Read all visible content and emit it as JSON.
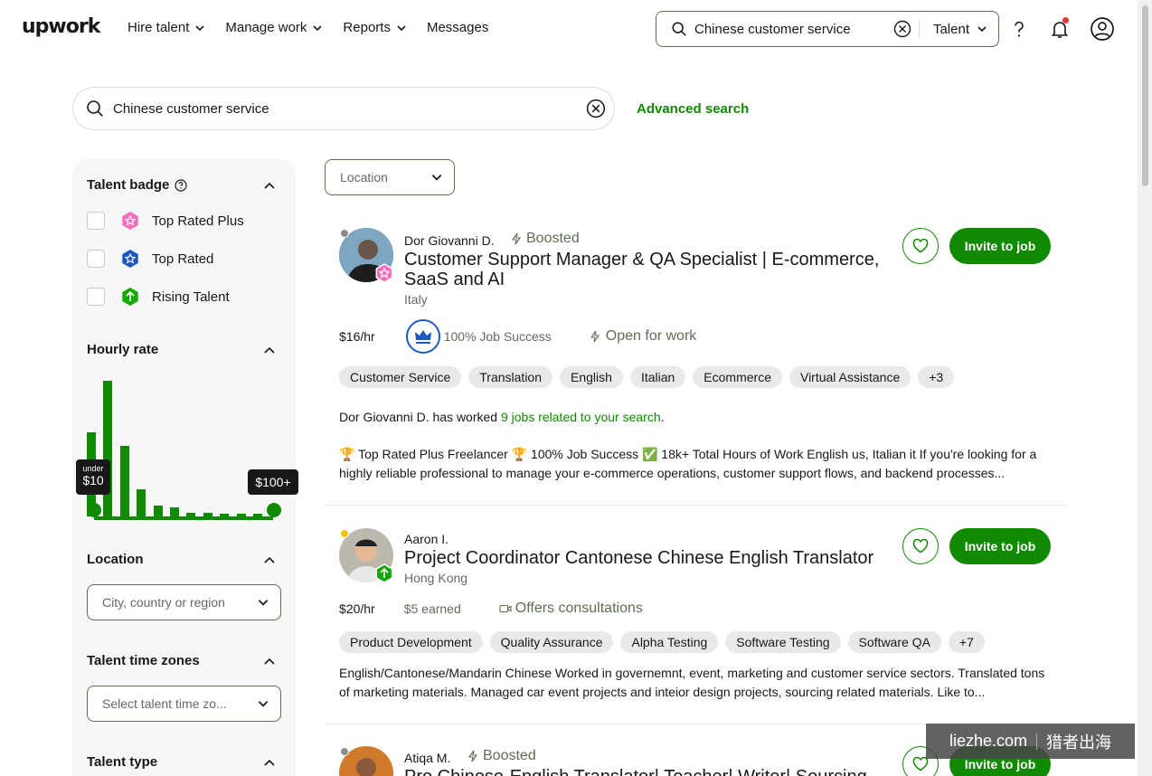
{
  "nav": {
    "logo": "upwork",
    "links": [
      "Hire talent",
      "Manage work",
      "Reports",
      "Messages"
    ],
    "search_value": "Chinese customer service",
    "search_scope": "Talent"
  },
  "search": {
    "value": "Chinese customer service",
    "advanced_label": "Advanced search"
  },
  "sidebar": {
    "talent_badge_title": "Talent badge",
    "badges": [
      "Top Rated Plus",
      "Top Rated",
      "Rising Talent"
    ],
    "hourly_rate_title": "Hourly rate",
    "histogram": [
      0.62,
      1.0,
      0.52,
      0.2,
      0.08,
      0.07,
      0.03,
      0.03,
      0.02,
      0.02,
      0.02
    ],
    "range_min_small": "under",
    "range_min": "$10",
    "range_max": "$100+",
    "location_title": "Location",
    "location_placeholder": "City, country or region",
    "timezones_title": "Talent time zones",
    "timezones_placeholder": "Select talent time zo...",
    "talent_type_title": "Talent type"
  },
  "results": {
    "location_filter": "Location",
    "freelancers": [
      {
        "name": "Dor Giovanni D.",
        "boosted": "Boosted",
        "title": "Customer Support Manager & QA Specialist | E-commerce, SaaS and AI",
        "location": "Italy",
        "rate": "$16/hr",
        "job_success": "100% Job Success",
        "extra": "Open for work",
        "skills": [
          "Customer Service",
          "Translation",
          "English",
          "Italian",
          "Ecommerce",
          "Virtual Assistance",
          "+3"
        ],
        "worked_prefix": "Dor Giovanni D. has worked ",
        "worked_link": "9 jobs related to your search",
        "worked_suffix": ".",
        "description": "🏆 Top Rated Plus Freelancer 🏆 100% Job Success ✅ 18k+ Total Hours of Work English us, Italian it If you're looking for a highly reliable professional to manage your e-commerce operations, customer support flows, and backend processes...",
        "invite_label": "Invite to job"
      },
      {
        "name": "Aaron I.",
        "title": "Project Coordinator Cantonese Chinese English Translator",
        "location": "Hong Kong",
        "rate": "$20/hr",
        "earned": "$5 earned",
        "extra": "Offers consultations",
        "skills": [
          "Product Development",
          "Quality Assurance",
          "Alpha Testing",
          "Software Testing",
          "Software QA",
          "+7"
        ],
        "description": "English/Cantonese/Mandarin Chinese Worked in governemnt, event, marketing and customer service sectors. Translated tons of marketing materials. Managed car event projects and inteior design projects, sourcing related materials. Like to...",
        "invite_label": "Invite to job"
      },
      {
        "name": "Atiqa M.",
        "boosted": "Boosted",
        "title": "Pro Chinese-English Translator| Teacher| Writer| Sourcing",
        "invite_label": "Invite to job"
      }
    ]
  },
  "watermark": {
    "left": "liezhe.com",
    "right": "猎者出海"
  },
  "colors": {
    "brand": "#108a00",
    "text": "#181818",
    "muted": "#676767"
  }
}
